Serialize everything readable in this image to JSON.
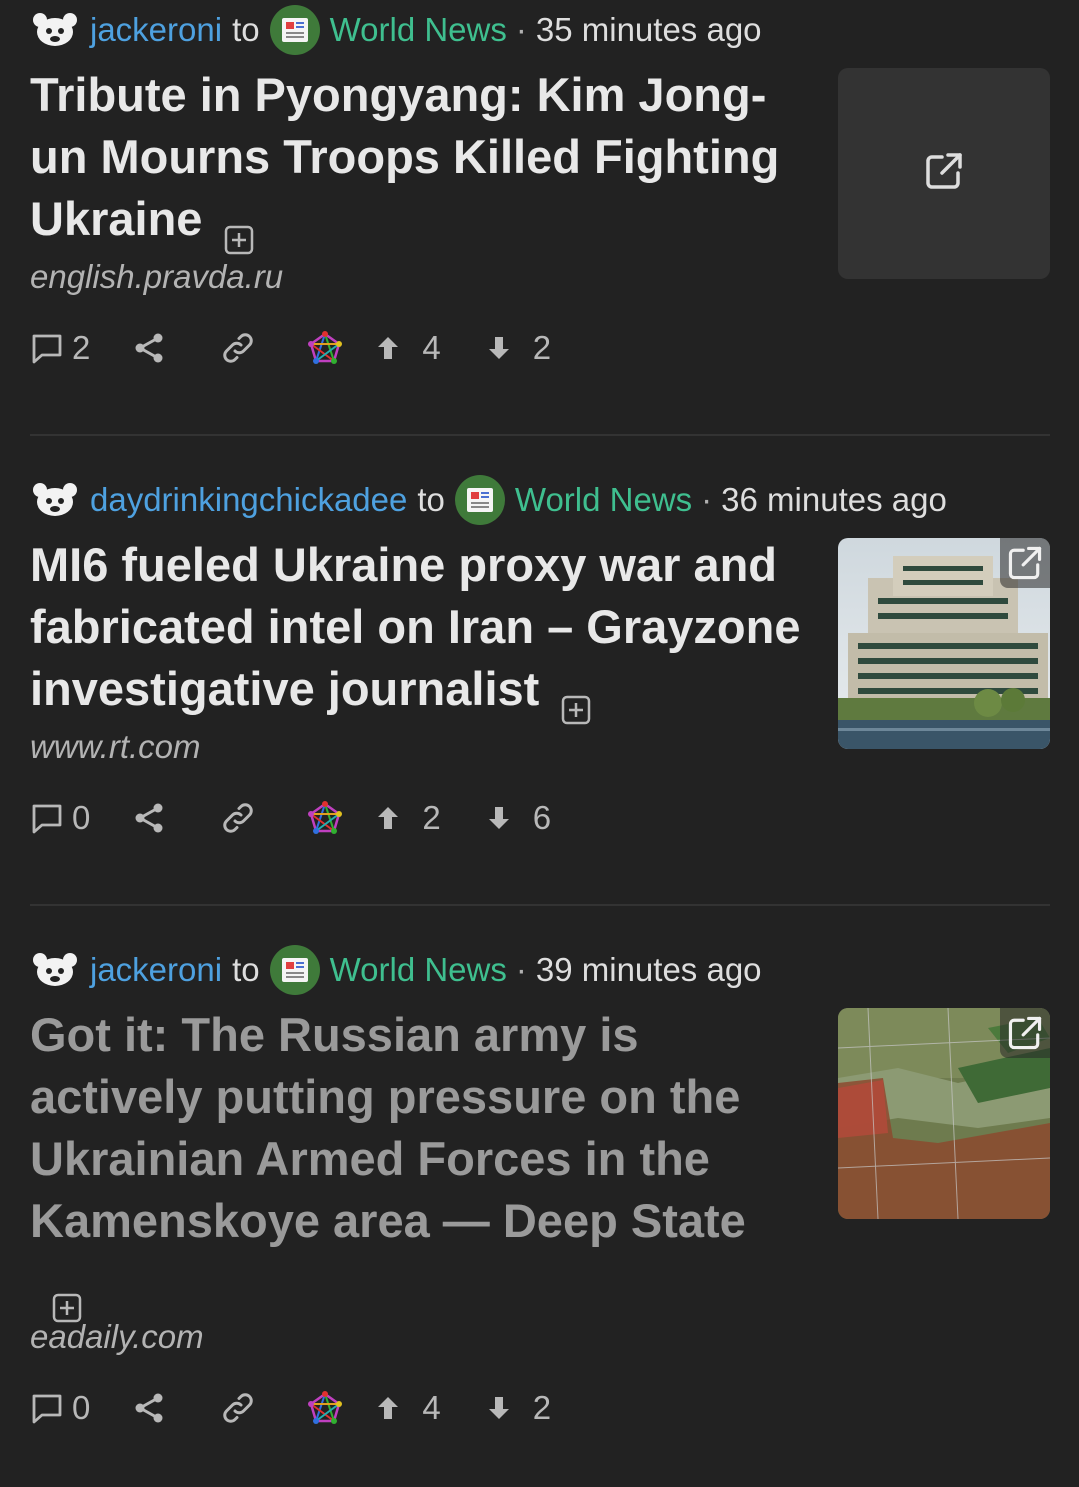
{
  "posts": [
    {
      "user": "jackeroni",
      "to": "to",
      "community": "World News",
      "dot": "·",
      "time": "35 minutes ago",
      "title": "Tribute in Pyongyang: Kim Jong-un Mourns Troops Killed Fighting Ukraine",
      "domain": "english.pravda.ru",
      "comments": "2",
      "upvotes": "4",
      "downvotes": "2",
      "thumbnail": "none",
      "read": false
    },
    {
      "user": "daydrinkingchickadee",
      "to": "to",
      "community": "World News",
      "dot": "·",
      "time": "36 minutes ago",
      "title": "MI6 fueled Ukraine proxy war and fabricated intel on Iran – Grayzone investigative journalist",
      "domain": "www.rt.com",
      "comments": "0",
      "upvotes": "2",
      "downvotes": "6",
      "thumbnail": "building-photo",
      "read": false
    },
    {
      "user": "jackeroni",
      "to": "to",
      "community": "World News",
      "dot": "·",
      "time": "39 minutes ago",
      "title": "Got it: The Russian army is actively putting pressure on the Ukrainian Armed Forces in the Kamenskoye area — Deep State",
      "domain": "eadaily.com",
      "comments": "0",
      "upvotes": "4",
      "downvotes": "2",
      "thumbnail": "map-image",
      "read": true
    }
  ],
  "colors": {
    "background": "#222222",
    "user_link": "#4ea1e0",
    "community_link": "#3fbf8f",
    "title": "#e8e8e8",
    "title_read": "#9a9a9a"
  }
}
